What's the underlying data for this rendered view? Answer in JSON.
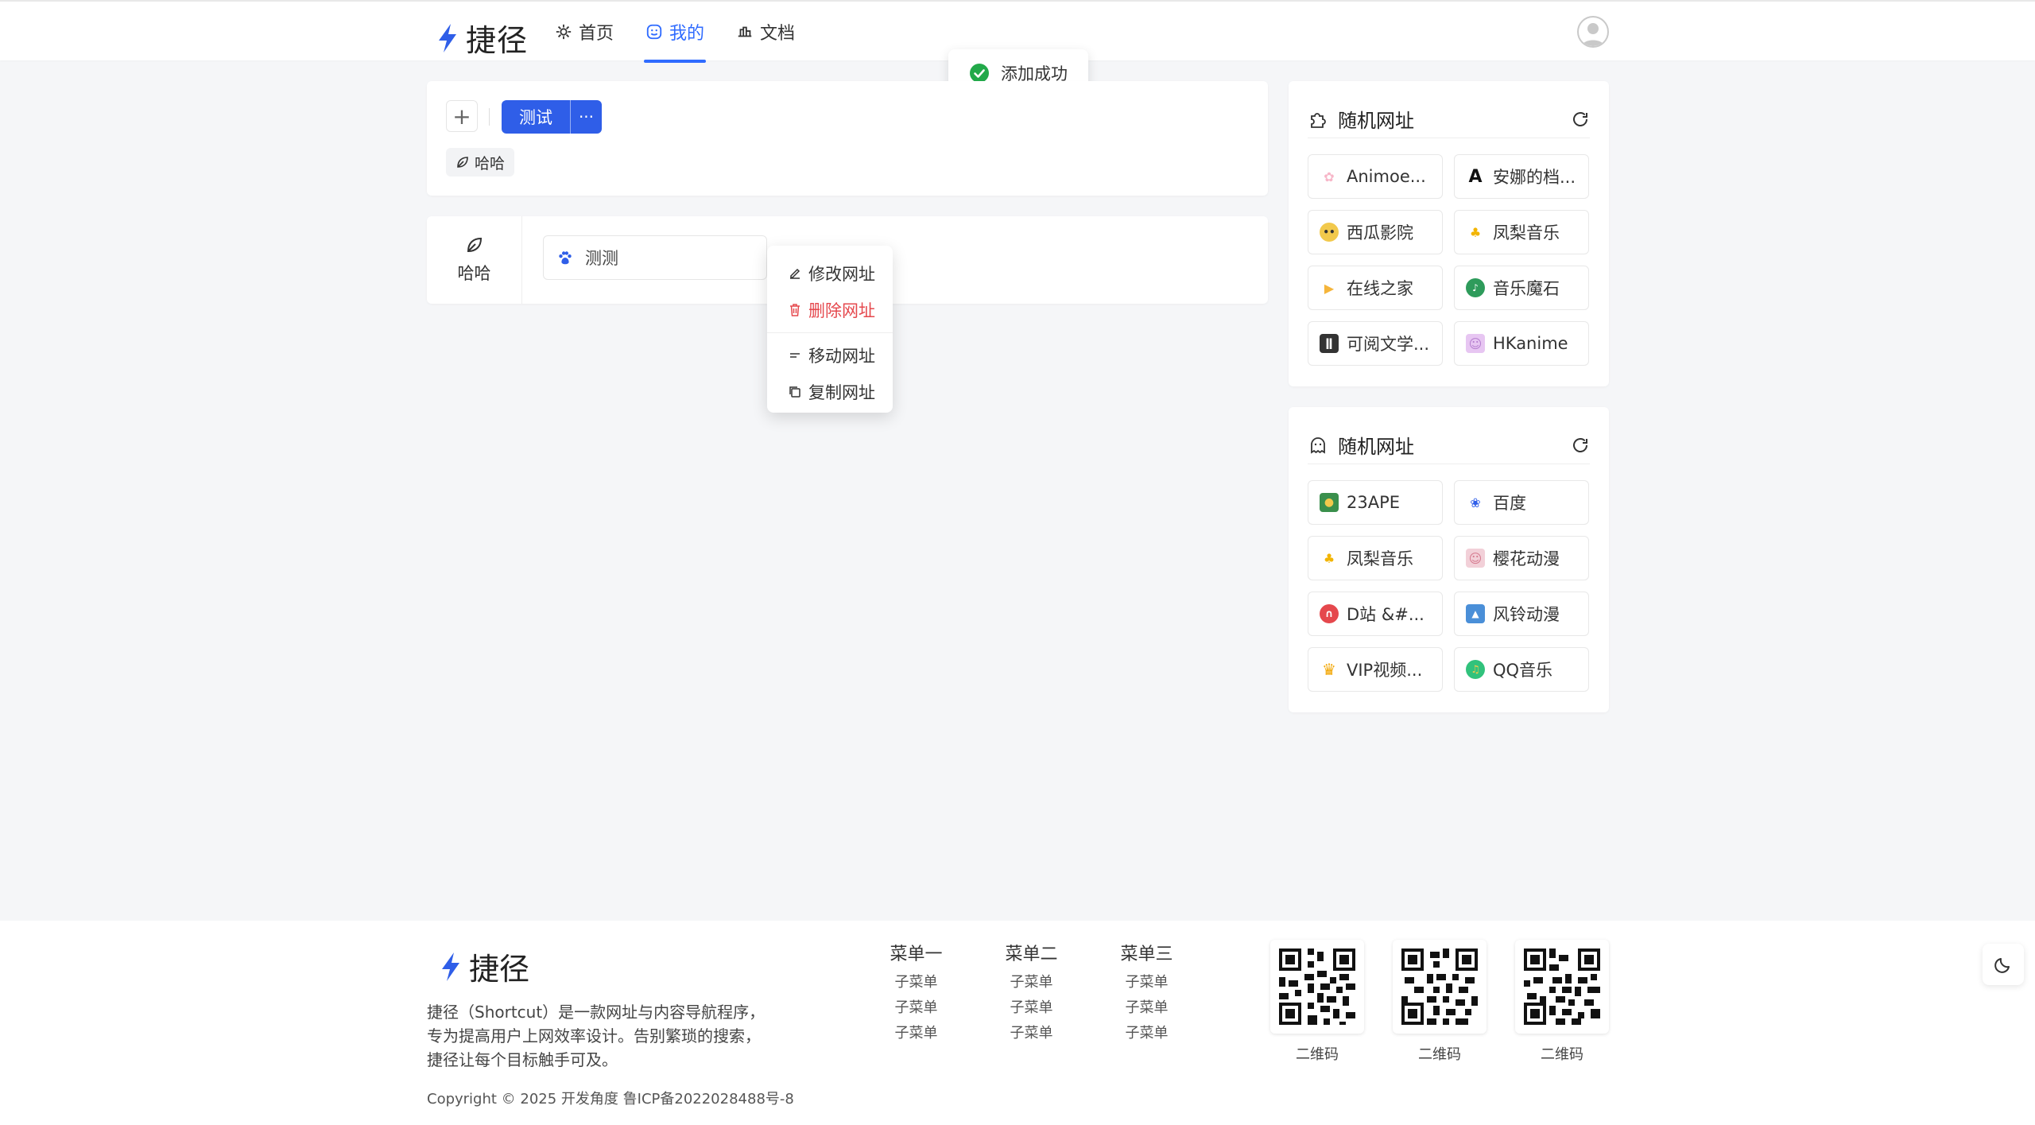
{
  "header": {
    "logo_text": "捷径",
    "nav": [
      {
        "label": "首页",
        "icon": "gear-icon"
      },
      {
        "label": "我的",
        "icon": "smile-icon",
        "active": true
      },
      {
        "label": "文档",
        "icon": "doc-icon"
      }
    ]
  },
  "toast": {
    "text": "添加成功",
    "status_color": "#22a94a"
  },
  "toolbar": {
    "add_label": "+",
    "group_label": "测试",
    "more_label": "···",
    "tag_label": "哈哈"
  },
  "list": {
    "side_label": "哈哈",
    "site_label": "测测"
  },
  "context_menu": {
    "items": [
      {
        "label": "修改网址"
      },
      {
        "label": "删除网址",
        "danger": true
      },
      {
        "label": "移动网址"
      },
      {
        "label": "复制网址"
      }
    ]
  },
  "random_panels": [
    {
      "title": "随机网址",
      "items": [
        {
          "label": "Animoe...",
          "icon": "sakura-icon",
          "color": "#f7b6c8"
        },
        {
          "label": "安娜的档...",
          "icon": "letter-a-icon",
          "color": "#111111"
        },
        {
          "label": "西瓜影院",
          "icon": "emoji-icon",
          "color": "#f2c94c"
        },
        {
          "label": "凤梨音乐",
          "icon": "pineapple-icon",
          "color": "#f2b400"
        },
        {
          "label": "在线之家",
          "icon": "play-icon",
          "color": "#f5b53b"
        },
        {
          "label": "音乐魔石",
          "icon": "disc-icon",
          "color": "#2e9b5b"
        },
        {
          "label": "可阅文学...",
          "icon": "book-icon",
          "color": "#333333"
        },
        {
          "label": "HKanime",
          "icon": "anime-icon",
          "color": "#b67fd0"
        }
      ]
    },
    {
      "title": "随机网址",
      "items": [
        {
          "label": "23APE",
          "icon": "ape-icon",
          "color": "#3a8f4c"
        },
        {
          "label": "百度",
          "icon": "paw-icon",
          "color": "#2f5ee8"
        },
        {
          "label": "凤梨音乐",
          "icon": "pineapple-icon",
          "color": "#f2b400"
        },
        {
          "label": "樱花动漫",
          "icon": "anime-icon",
          "color": "#d67a8f"
        },
        {
          "label": "D站 &#...",
          "icon": "d-icon",
          "color": "#e5484d"
        },
        {
          "label": "风铃动漫",
          "icon": "picture-icon",
          "color": "#4a8fd8"
        },
        {
          "label": "VIP视频...",
          "icon": "crown-icon",
          "color": "#f2a500"
        },
        {
          "label": "QQ音乐",
          "icon": "qq-music-icon",
          "color": "#31c27c"
        }
      ]
    }
  ],
  "footer": {
    "logo_text": "捷径",
    "description": "捷径（Shortcut）是一款网址与内容导航程序，专为提高用户上网效率设计。告别繁琐的搜索，捷径让每个目标触手可及。",
    "copyright": "Copyright © 2025 开发角度 鲁ICP备2022028488号-8",
    "menus": [
      {
        "title": "菜单一",
        "items": [
          "子菜单",
          "子菜单",
          "子菜单"
        ]
      },
      {
        "title": "菜单二",
        "items": [
          "子菜单",
          "子菜单",
          "子菜单"
        ]
      },
      {
        "title": "菜单三",
        "items": [
          "子菜单",
          "子菜单",
          "子菜单"
        ]
      }
    ],
    "qrcodes": [
      {
        "label": "二维码"
      },
      {
        "label": "二维码"
      },
      {
        "label": "二维码"
      }
    ]
  },
  "colors": {
    "accent": "#2f5ee8",
    "danger": "#e5484d"
  }
}
